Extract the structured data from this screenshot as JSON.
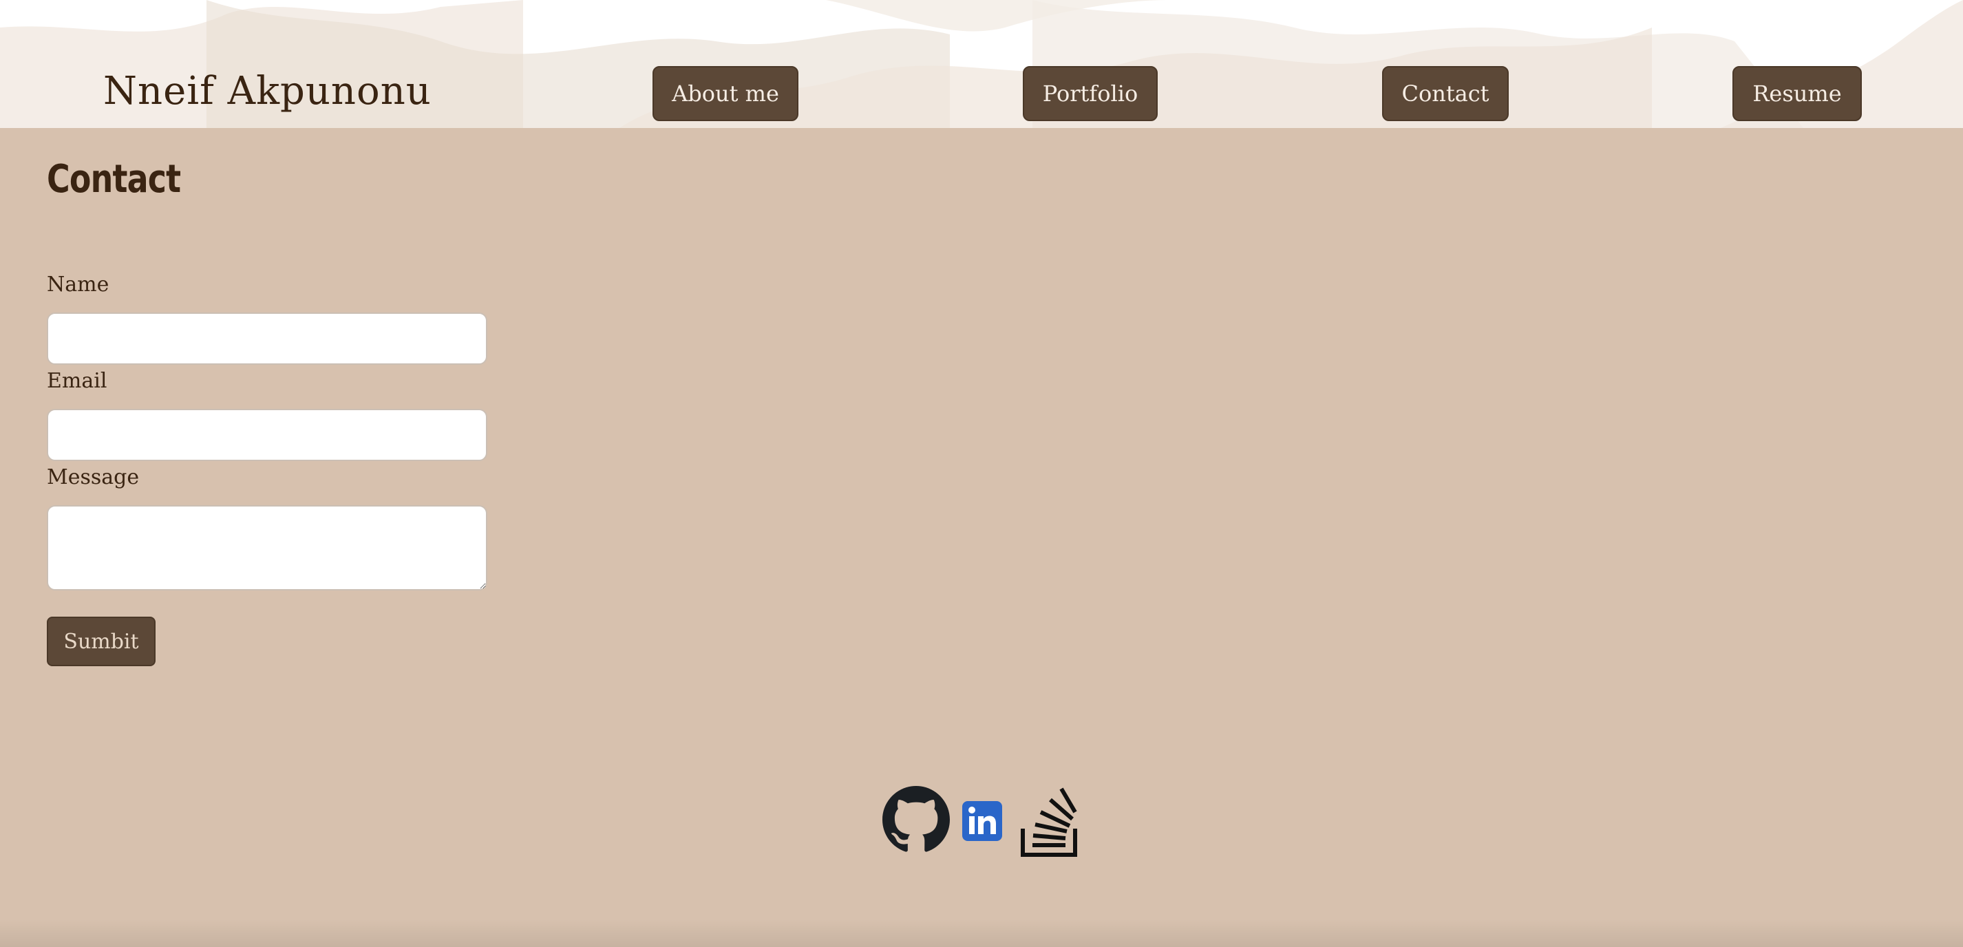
{
  "header": {
    "brand": "Nneif Akpunonu",
    "nav": [
      {
        "label": "About me"
      },
      {
        "label": "Portfolio"
      },
      {
        "label": "Contact"
      },
      {
        "label": "Resume"
      }
    ]
  },
  "contact": {
    "title": "Contact",
    "fields": {
      "name": {
        "label": "Name",
        "value": ""
      },
      "email": {
        "label": "Email",
        "value": ""
      },
      "message": {
        "label": "Message",
        "value": ""
      }
    },
    "submit_label": "Sumbit"
  },
  "socials": [
    {
      "icon": "github-icon"
    },
    {
      "icon": "linkedin-icon"
    },
    {
      "icon": "stackoverflow-icon"
    }
  ],
  "colors": {
    "page_background": "#d7c1ae",
    "header_background": "#ffffff",
    "button_background": "#5c4837",
    "text_dark": "#3a2412",
    "linkedin_blue": "#2a66c9"
  }
}
